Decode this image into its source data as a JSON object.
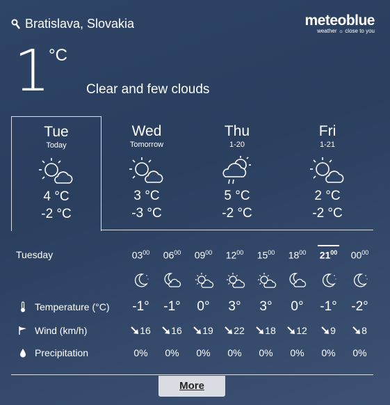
{
  "location": {
    "name": "Bratislava, Slovakia"
  },
  "brand": {
    "name": "meteoblue",
    "tagline": "weather ☼ close to you"
  },
  "current": {
    "temp": "1",
    "unit": "°C",
    "desc": "Clear and few clouds"
  },
  "days": [
    {
      "name": "Tue",
      "sub": "Today",
      "icon": "sun-cloud-icon",
      "max": "4 °C",
      "min": "-2 °C"
    },
    {
      "name": "Wed",
      "sub": "Tomorrow",
      "icon": "sun-cloud-icon",
      "max": "3 °C",
      "min": "-3 °C"
    },
    {
      "name": "Thu",
      "sub": "1-20",
      "icon": "sun-cloud-rain-icon",
      "max": "5 °C",
      "min": "-2 °C"
    },
    {
      "name": "Fri",
      "sub": "1-21",
      "icon": "sun-cloud-icon",
      "max": "2 °C",
      "min": "-2 °C"
    }
  ],
  "hourly": {
    "day_label": "Tuesday",
    "hours": [
      {
        "h": "03",
        "m": "00"
      },
      {
        "h": "06",
        "m": "00"
      },
      {
        "h": "09",
        "m": "00"
      },
      {
        "h": "12",
        "m": "00"
      },
      {
        "h": "15",
        "m": "00"
      },
      {
        "h": "18",
        "m": "00"
      },
      {
        "h": "21",
        "m": "00"
      },
      {
        "h": "00",
        "m": "00"
      }
    ],
    "icons": [
      "moon-icon",
      "moon-cloud-icon",
      "sun-cloud-icon",
      "sun-cloud-icon",
      "sun-cloud-icon",
      "moon-cloud-icon",
      "moon-icon",
      "moon-icon"
    ],
    "temp_label": "Temperature (°C)",
    "temps": [
      "-1°",
      "-1°",
      "0°",
      "3°",
      "3°",
      "0°",
      "-1°",
      "-2°"
    ],
    "wind_label": "Wind (km/h)",
    "winds": [
      "16",
      "16",
      "19",
      "22",
      "18",
      "12",
      "9",
      "8"
    ],
    "precip_label": "Precipitation",
    "precips": [
      "0%",
      "0%",
      "0%",
      "0%",
      "0%",
      "0%",
      "0%",
      "0%"
    ]
  },
  "more_label": "More"
}
